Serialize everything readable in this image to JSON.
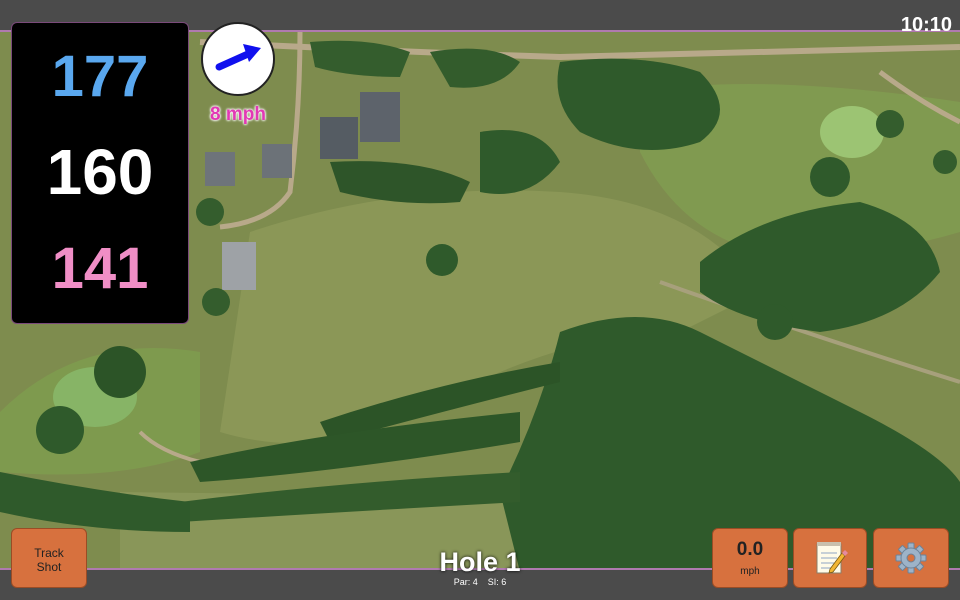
{
  "status": {
    "time": "10:10"
  },
  "yardages": {
    "back": "177",
    "middle": "160",
    "front": "141",
    "colors": {
      "back": "#5aa8ef",
      "middle": "#ffffff",
      "front": "#f08ec6"
    }
  },
  "wind": {
    "speed_label": "8 mph",
    "arrow_icon": "arrow-right-icon"
  },
  "buttons": {
    "track_shot": {
      "line1": "Track",
      "line2": "Shot"
    },
    "speed": {
      "value": "0.0",
      "unit": "mph"
    },
    "notes_icon": "notepad-icon",
    "settings_icon": "gear-icon",
    "accent": "#d7713e"
  },
  "hole": {
    "title": "Hole 1",
    "par": "Par: 4",
    "stroke_index": "SI: 6"
  }
}
